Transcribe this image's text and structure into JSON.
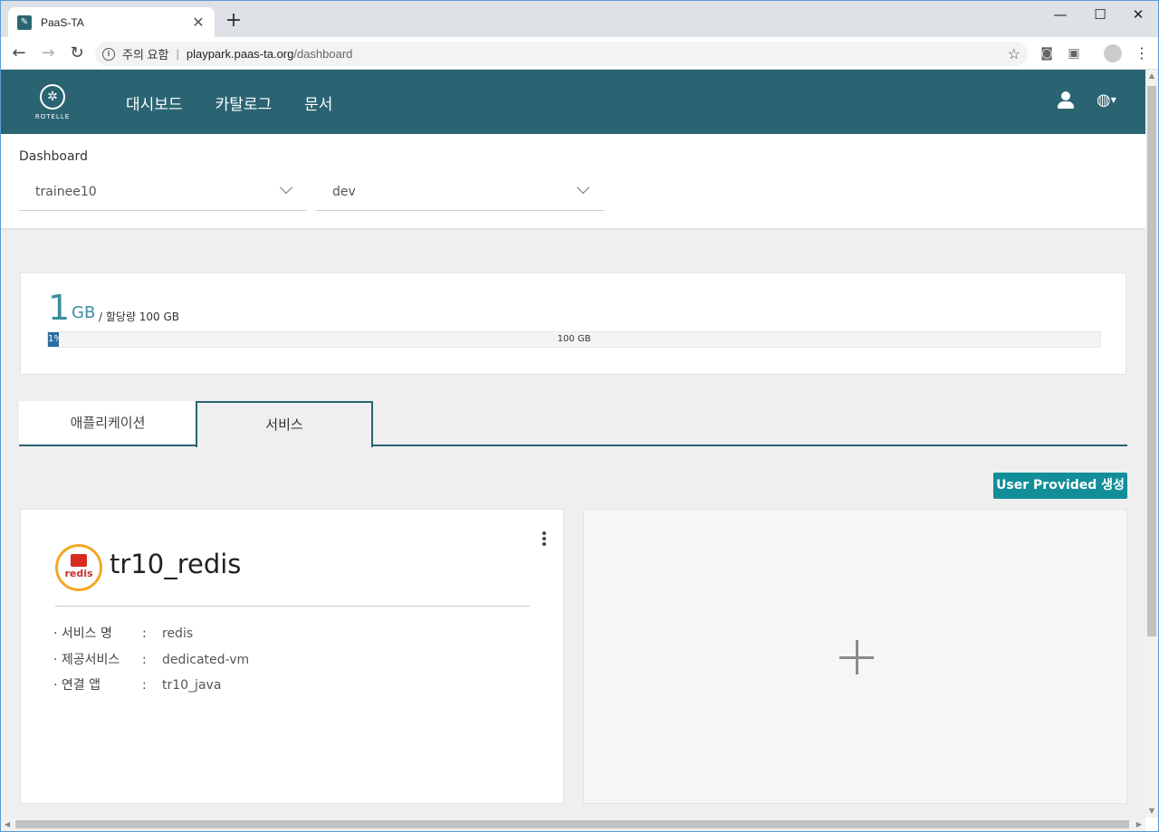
{
  "browser": {
    "tab_title": "PaaS-TA",
    "tab_close": "✕",
    "new_tab": "+",
    "security_text": "주의 요함",
    "url_host": "playpark.paas-ta.org",
    "url_path": "/dashboard",
    "window_controls": {
      "minimize": "—",
      "maximize": "☐",
      "close": "✕"
    }
  },
  "app": {
    "logo_text": "ROTELLE",
    "nav": [
      "대시보드",
      "카탈로그",
      "문서"
    ],
    "colors": {
      "header": "#2a6473",
      "accent": "#3b8fa0",
      "cta": "#128e99",
      "progress": "#2d6ea0"
    }
  },
  "filters": {
    "page_title": "Dashboard",
    "org_value": "trainee10",
    "space_value": "dev"
  },
  "usage": {
    "used_value": "1",
    "used_unit": "GB",
    "quota_text": "/ 할당량 100 GB",
    "progress_label": "1%",
    "progress_fraction": 0.01,
    "total_label": "100 GB"
  },
  "tabs": [
    {
      "label": "애플리케이션",
      "active": false
    },
    {
      "label": "서비스",
      "active": true
    }
  ],
  "actions": {
    "user_provided_create": "User Provided 생성"
  },
  "service_card": {
    "logo_text": "redis",
    "name": "tr10_redis",
    "rows": [
      {
        "label": "· 서비스 명",
        "value": "redis"
      },
      {
        "label": "· 제공서비스",
        "value": "dedicated-vm"
      },
      {
        "label": "· 연결 앱",
        "value": "tr10_java"
      }
    ],
    "colon": ":"
  }
}
